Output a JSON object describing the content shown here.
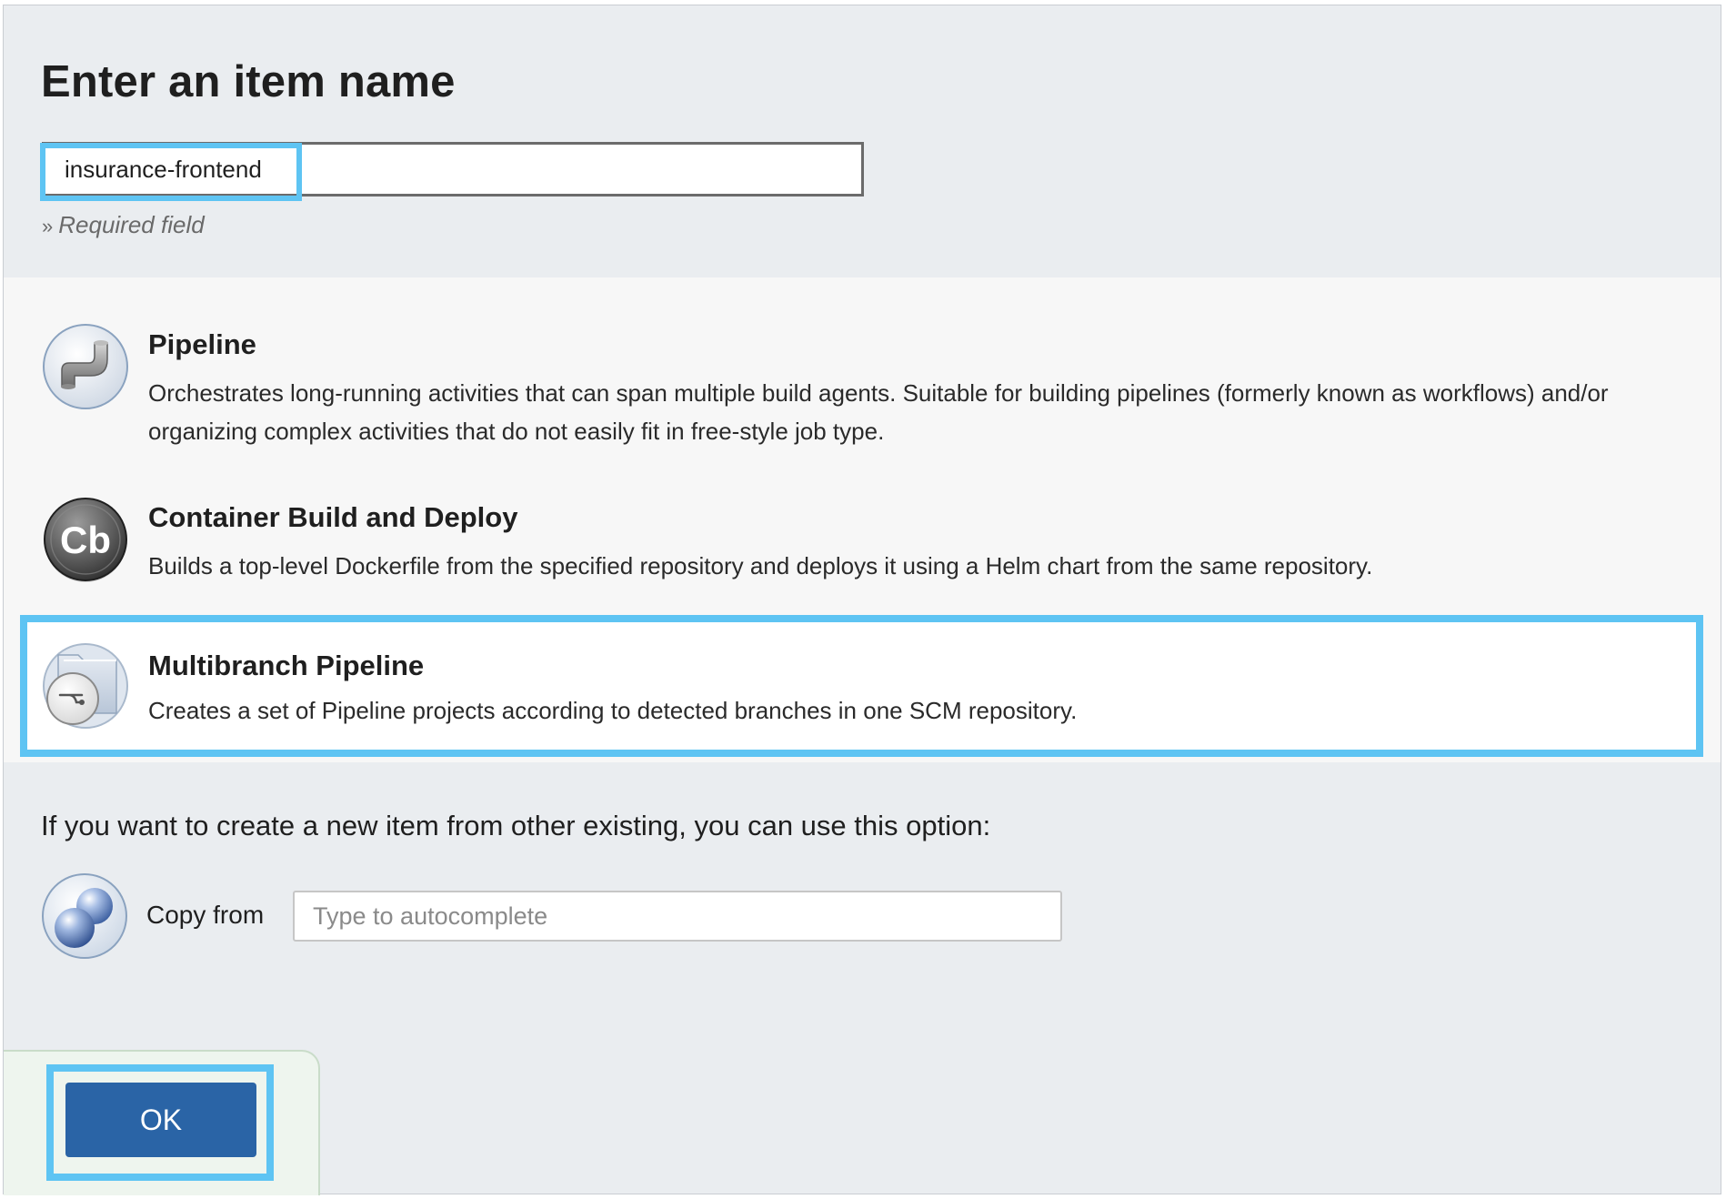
{
  "header": {
    "title": "Enter an item name",
    "name_value": "insurance-frontend",
    "required_marker": "»",
    "required_text": "Required field"
  },
  "item_types": [
    {
      "title": "Pipeline",
      "description": "Orchestrates long-running activities that can span multiple build agents. Suitable for building pipelines (formerly known as workflows) and/or organizing complex activities that do not easily fit in free-style job type.",
      "icon": "pipeline-icon",
      "selected": false
    },
    {
      "title": "Container Build and Deploy",
      "description": "Builds a top-level Dockerfile from the specified repository and deploys it using a Helm chart from the same repository.",
      "icon": "container-build-icon",
      "icon_text": "Cb",
      "selected": false
    },
    {
      "title": "Multibranch Pipeline",
      "description": "Creates a set of Pipeline projects according to detected branches in one SCM repository.",
      "icon": "multibranch-pipeline-icon",
      "selected": true
    }
  ],
  "copy": {
    "hint": "If you want to create a new item from other existing, you can use this option:",
    "label": "Copy from",
    "placeholder": "Type to autocomplete",
    "icon": "copy-item-icon"
  },
  "footer": {
    "ok_label": "OK"
  },
  "colors": {
    "highlight": "#5ec4f3",
    "ok_button": "#2a64a6",
    "section_bg": "#eaedf0",
    "types_bg": "#f7f7f7"
  }
}
